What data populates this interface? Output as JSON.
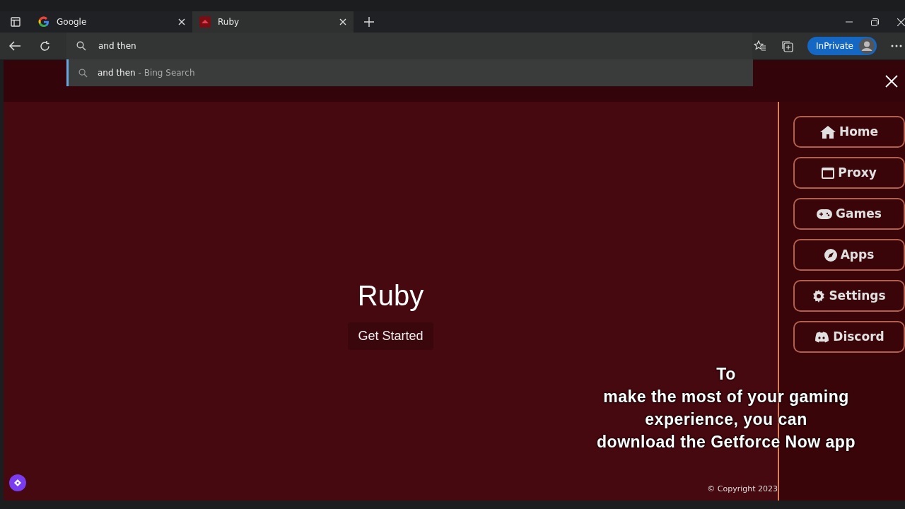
{
  "tabs": [
    {
      "label": "Google",
      "selected": false
    },
    {
      "label": "Ruby",
      "selected": true
    }
  ],
  "address_bar": {
    "value": "and then "
  },
  "suggestions": [
    {
      "text": "and then",
      "source": "- Bing Search",
      "selected": true
    }
  ],
  "profile": {
    "label": "InPrivate"
  },
  "page": {
    "title": "Ruby",
    "button": "Get Started",
    "nav": [
      {
        "label": "Home"
      },
      {
        "label": "Proxy"
      },
      {
        "label": "Games"
      },
      {
        "label": "Apps"
      },
      {
        "label": "Settings"
      },
      {
        "label": "Discord"
      }
    ],
    "caption_lines": [
      "To",
      "make the most of your gaming",
      "experience, you can",
      "download the Getforce Now app"
    ],
    "copyright": "© Copyright 2023"
  }
}
